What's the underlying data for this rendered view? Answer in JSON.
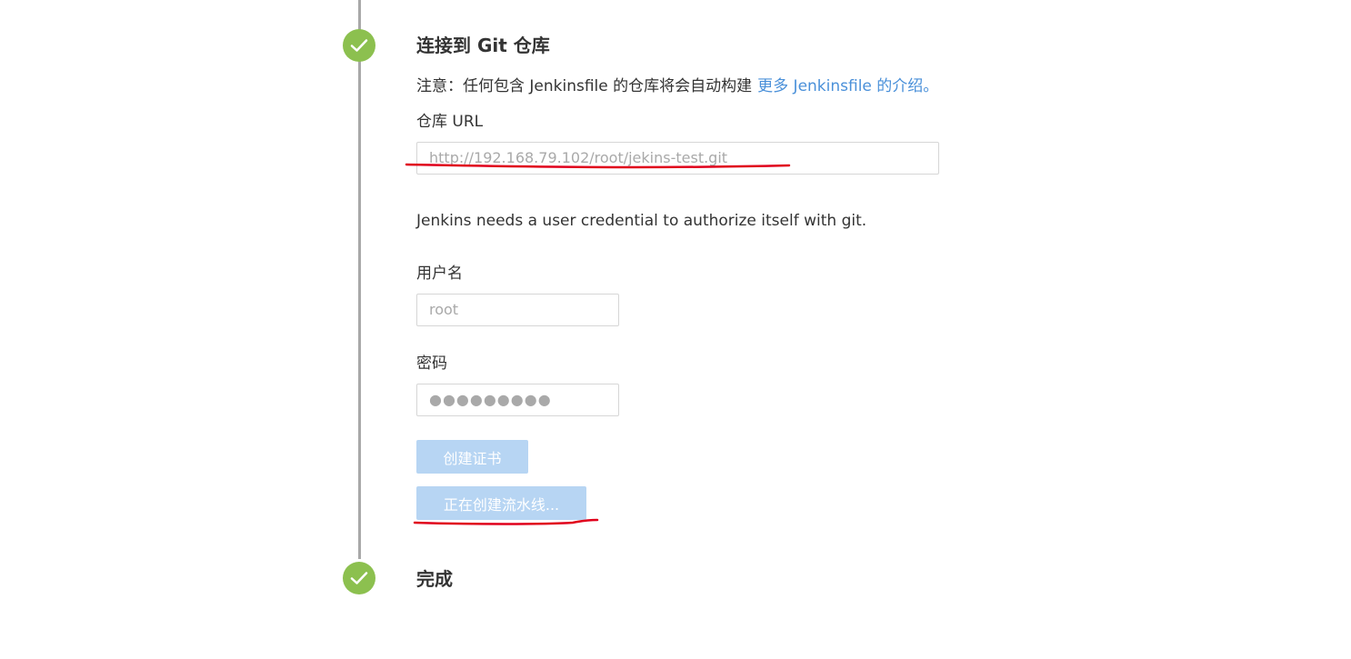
{
  "steps": [
    {
      "title": "连接到 Git 仓库",
      "status": "complete"
    },
    {
      "title": "完成",
      "status": "complete"
    }
  ],
  "note": {
    "text": "注意：任何包含 Jenkinsfile 的仓库将会自动构建",
    "link_text": "更多 Jenkinsfile 的介绍。"
  },
  "repo": {
    "label": "仓库 URL",
    "value": "http://192.168.79.102/root/jekins-test.git"
  },
  "credential_help": "Jenkins needs a user credential to authorize itself with git.",
  "username": {
    "label": "用户名",
    "value": "root"
  },
  "password": {
    "label": "密码",
    "value": "●●●●●●●●●"
  },
  "buttons": {
    "create_credential": "创建证书",
    "creating_pipeline": "正在创建流水线..."
  },
  "colors": {
    "check_green": "#8cc04f",
    "link_blue": "#4a90d9",
    "button_disabled_blue": "#b7d5f3",
    "annotation_red": "#e0001b"
  }
}
